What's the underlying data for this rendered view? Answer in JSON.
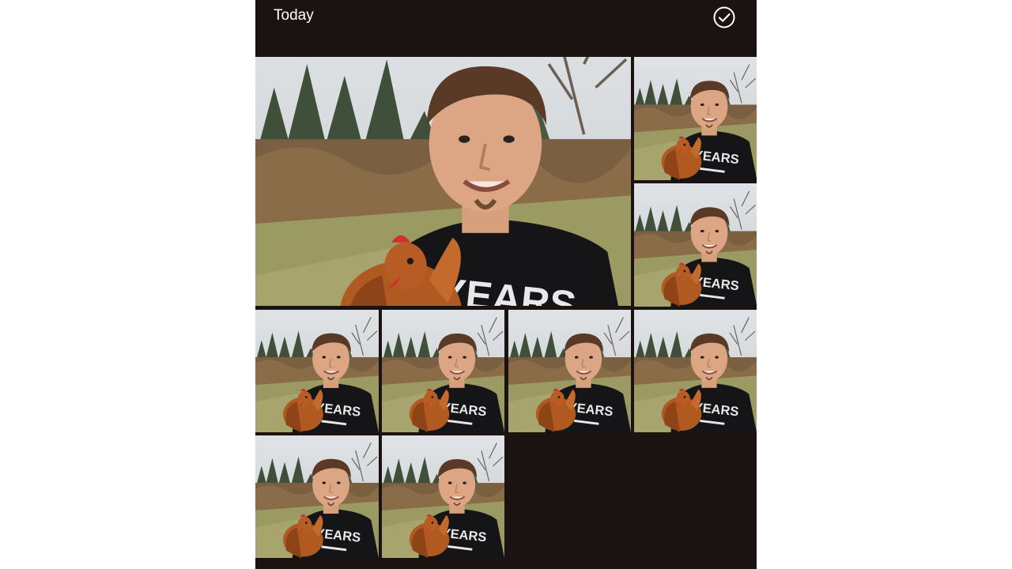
{
  "header": {
    "title": "Today",
    "select_icon": "check-circle-icon"
  },
  "photos": [
    {
      "id": "photo-1",
      "kind": "selfie-with-chicken",
      "shirt_text": "0 YEARS"
    },
    {
      "id": "photo-2",
      "kind": "selfie-with-chicken",
      "shirt_text": "0 YEARS"
    },
    {
      "id": "photo-3",
      "kind": "selfie-with-chicken",
      "shirt_text": "0 YEARS"
    },
    {
      "id": "photo-4",
      "kind": "selfie-with-chicken",
      "shirt_text": "0 YEARS"
    },
    {
      "id": "photo-5",
      "kind": "selfie-with-chicken",
      "shirt_text": "0 YEARS"
    },
    {
      "id": "photo-6",
      "kind": "selfie-with-chicken",
      "shirt_text": "0 YEARS"
    },
    {
      "id": "photo-7",
      "kind": "selfie-with-chicken",
      "shirt_text": "0 YEARS"
    },
    {
      "id": "photo-8",
      "kind": "selfie-with-chicken",
      "shirt_text": "0 YEARS"
    },
    {
      "id": "photo-9",
      "kind": "selfie-with-chicken",
      "shirt_text": "0 YEARS"
    }
  ],
  "colors": {
    "background": "#1b1212",
    "header_text": "#ffffff"
  }
}
